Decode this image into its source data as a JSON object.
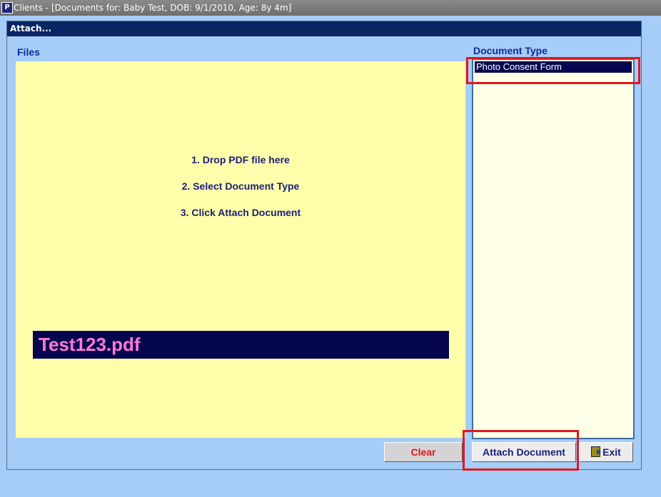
{
  "window": {
    "title": "Clients - [Documents for: Baby Test, DOB: 9/1/2010, Age: 8y 4m]",
    "app_icon": "access-form-icon"
  },
  "form": {
    "header": "Attach...",
    "files_label": "Files",
    "doctype_label": "Document Type"
  },
  "dropzone": {
    "instructions": [
      "1. Drop PDF file here",
      "2. Select Document Type",
      "3. Click Attach Document"
    ],
    "file_name": "Test123.pdf"
  },
  "document_types": {
    "items": [
      "Photo Consent Form"
    ],
    "selected": "Photo Consent Form"
  },
  "buttons": {
    "clear": "Clear",
    "attach": "Attach Document",
    "exit": "Exit",
    "exit_icon": "exit-door-icon"
  },
  "colors": {
    "background": "#a6cdf7",
    "header": "#0b2665",
    "dropzone": "#ffffab",
    "file_bar": "#06064e",
    "file_text": "#ff7ad3",
    "clear_text": "#e8141b",
    "highlight": "#e3171e"
  }
}
